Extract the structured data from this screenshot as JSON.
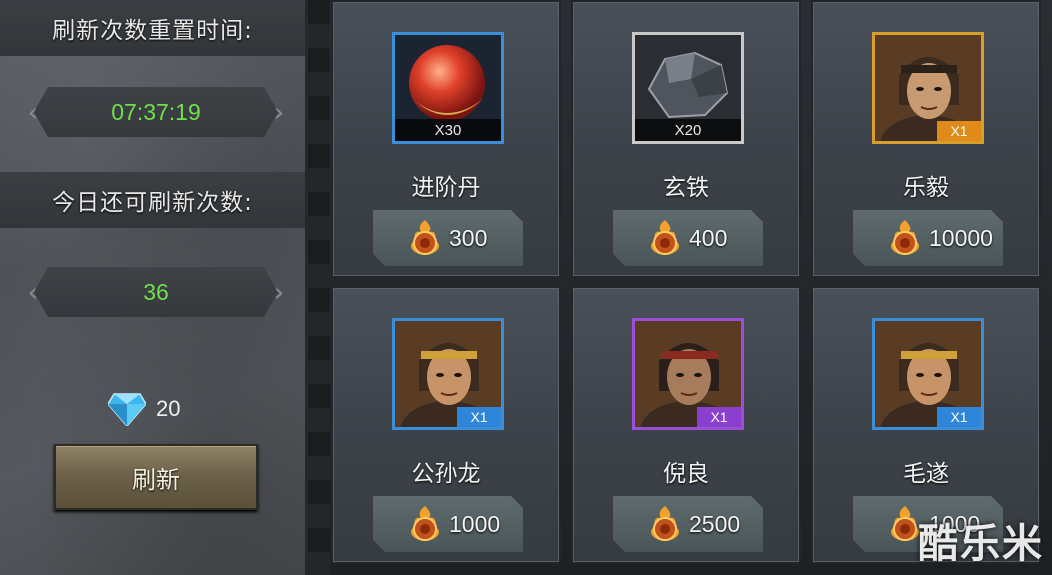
{
  "left_panel": {
    "reset_time_label": "刷新次数重置时间:",
    "reset_time_value": "07:37:19",
    "remaining_label": "今日还可刷新次数:",
    "remaining_value": "36",
    "gem_count": "20",
    "refresh_button": "刷新"
  },
  "shop_items": [
    {
      "name": "进阶丹",
      "qty": "X30",
      "price": "300",
      "frame": "blue",
      "icon": "red-orb-icon"
    },
    {
      "name": "玄铁",
      "qty": "X20",
      "price": "400",
      "frame": "plain",
      "icon": "iron-ore-icon"
    },
    {
      "name": "乐毅",
      "qty": "X1",
      "price": "10000",
      "frame": "gold",
      "icon": "hero-portrait-icon"
    },
    {
      "name": "公孙龙",
      "qty": "X1",
      "price": "1000",
      "frame": "blue",
      "icon": "hero-portrait-icon"
    },
    {
      "name": "倪良",
      "qty": "X1",
      "price": "2500",
      "frame": "purple",
      "icon": "hero-portrait-icon"
    },
    {
      "name": "毛遂",
      "qty": "X1",
      "price": "1000",
      "frame": "blue",
      "icon": "hero-portrait-icon"
    }
  ],
  "watermark": "酷乐米",
  "colors": {
    "timer_green": "#6fe04a",
    "frame_blue": "#3a6ab8",
    "frame_gold": "#d7a02e",
    "frame_purple": "#9a4fd6"
  }
}
